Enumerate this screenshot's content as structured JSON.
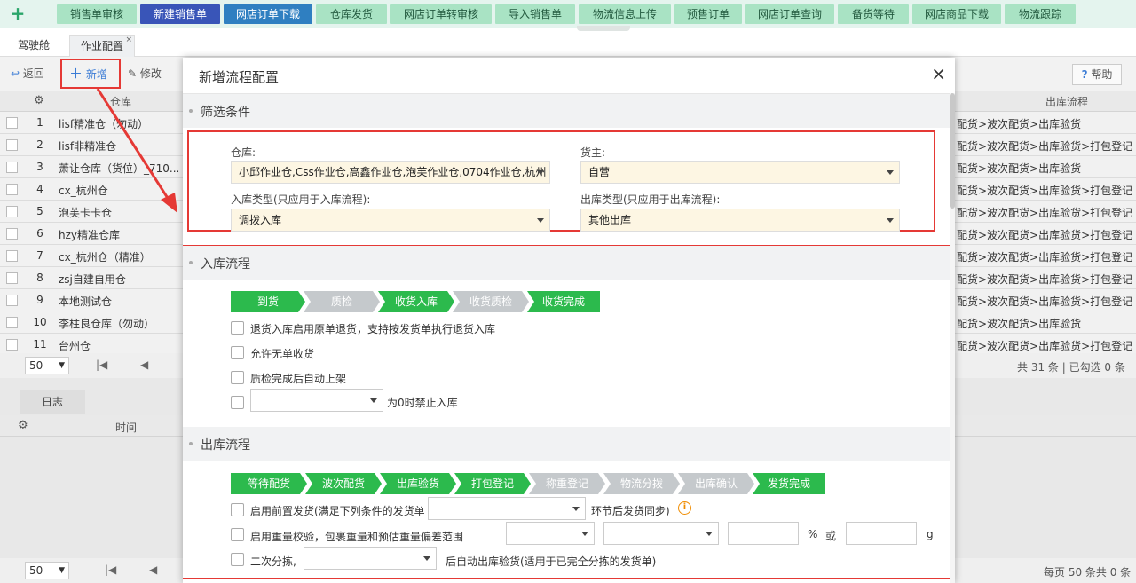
{
  "topnav": {
    "items": [
      "销售单审核",
      "新建销售单",
      "网店订单下载",
      "仓库发货",
      "网店订单转审核",
      "导入销售单",
      "物流信息上传",
      "预售订单",
      "网店订单查询",
      "备货等待",
      "网店商品下载",
      "物流跟踪"
    ]
  },
  "tabs": {
    "cockpit": "驾驶舱",
    "job_config": "作业配置",
    "close": "×"
  },
  "toolbar": {
    "back": "返回",
    "add": "新增",
    "edit": "修改",
    "help": "帮助"
  },
  "grid": {
    "col_warehouse": "仓库",
    "col_flow": "出库流程",
    "rows": [
      {
        "no": "1",
        "warehouse": "lisf精准仓（勿动）",
        "flow": "配货>波次配货>出库验货"
      },
      {
        "no": "2",
        "warehouse": "lisf非精准仓",
        "flow": "配货>波次配货>出库验货>打包登记"
      },
      {
        "no": "3",
        "warehouse": "萧让仓库（货位）_710...",
        "flow": "配货>波次配货>出库验货"
      },
      {
        "no": "4",
        "warehouse": "cx_杭州仓",
        "flow": "配货>波次配货>出库验货>打包登记"
      },
      {
        "no": "5",
        "warehouse": "泡芙卡卡仓",
        "flow": "配货>波次配货>出库验货>打包登记"
      },
      {
        "no": "6",
        "warehouse": "hzy精准仓库",
        "flow": "配货>波次配货>出库验货>打包登记"
      },
      {
        "no": "7",
        "warehouse": "cx_杭州仓（精准）",
        "flow": "配货>波次配货>出库验货>打包登记"
      },
      {
        "no": "8",
        "warehouse": "zsj自建自用仓",
        "flow": "配货>波次配货>出库验货>打包登记"
      },
      {
        "no": "9",
        "warehouse": "本地测试仓",
        "flow": "配货>波次配货>出库验货>打包登记"
      },
      {
        "no": "10",
        "warehouse": "李柱良仓库（勿动）",
        "flow": "配货>波次配货>出库验货"
      },
      {
        "no": "11",
        "warehouse": "台州仓",
        "flow": "配货>波次配货>出库验货>打包登记"
      }
    ],
    "page_size": "50",
    "total": "共 31 条 | 已勾选 0 条"
  },
  "log": {
    "tab": "日志",
    "col_time": "时间",
    "page_size": "50",
    "total": "每页 50 条共 0 条"
  },
  "modal": {
    "title": "新增流程配置",
    "close": "×",
    "filter_title": "筛选条件",
    "warehouse_label": "仓库:",
    "warehouse_value": "小邱作业仓,Css作业仓,高鑫作业仓,泡芙作业仓,0704作业仓,杭州",
    "owner_label": "货主:",
    "owner_value": "自营",
    "in_type_label": "入库类型(只应用于入库流程):",
    "in_type_value": "调拨入库",
    "out_type_label": "出库类型(只应用于出库流程):",
    "out_type_value": "其他出库",
    "inbound_title": "入库流程",
    "inbound_steps": [
      {
        "label": "到货",
        "active": true
      },
      {
        "label": "质检",
        "active": false
      },
      {
        "label": "收货入库",
        "active": true
      },
      {
        "label": "收货质检",
        "active": false
      },
      {
        "label": "收货完成",
        "active": true
      }
    ],
    "inbound_opts": {
      "opt1": "退货入库启用原单退货，支持按发货单执行退货入库",
      "opt2": "允许无单收货",
      "opt3": "质检完成后自动上架",
      "opt4_suffix": "为0时禁止入库"
    },
    "outbound_title": "出库流程",
    "outbound_steps": [
      {
        "label": "等待配货",
        "active": true
      },
      {
        "label": "波次配货",
        "active": true
      },
      {
        "label": "出库验货",
        "active": true
      },
      {
        "label": "打包登记",
        "active": true
      },
      {
        "label": "称重登记",
        "active": false
      },
      {
        "label": "物流分拨",
        "active": false
      },
      {
        "label": "出库确认",
        "active": false
      },
      {
        "label": "发货完成",
        "active": true
      }
    ],
    "outbound_opts": {
      "opt1_prefix": "启用前置发货(满足下列条件的发货单",
      "opt1_suffix": "环节后发货同步)",
      "opt2": "启用重量校验，包裹重量和预估重量偏差范围",
      "opt2_pct": "%",
      "opt2_or": "或",
      "opt2_unit": "g",
      "opt3_prefix": "二次分拣,",
      "opt3_suffix": "后自动出库验货(适用于已完全分拣的发货单)"
    },
    "info_glyph": "i"
  },
  "colors": {
    "accent_green": "#2cba4d",
    "inactive_step": "#c5c9cc",
    "highlight_red": "#e53935",
    "nav_bg": "#a9e3c4"
  }
}
